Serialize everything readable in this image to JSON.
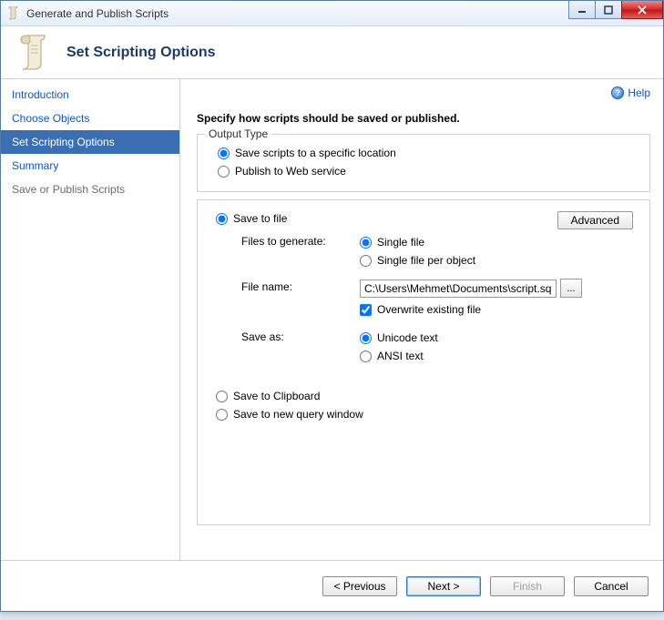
{
  "window": {
    "title": "Generate and Publish Scripts"
  },
  "header": {
    "title": "Set Scripting Options"
  },
  "help": {
    "label": "Help"
  },
  "sidebar": {
    "items": [
      {
        "label": "Introduction",
        "state": "done"
      },
      {
        "label": "Choose Objects",
        "state": "done"
      },
      {
        "label": "Set Scripting Options",
        "state": "selected"
      },
      {
        "label": "Summary",
        "state": "done"
      },
      {
        "label": "Save or Publish Scripts",
        "state": "pending"
      }
    ]
  },
  "content": {
    "instruction": "Specify how scripts should be saved or published.",
    "output_type": {
      "legend": "Output Type",
      "option_save_location": "Save scripts to a specific location",
      "option_publish_web": "Publish to Web service"
    },
    "save_to_file": {
      "label": "Save to file",
      "advanced_button": "Advanced",
      "files_to_generate_label": "Files to generate:",
      "single_file": "Single file",
      "single_file_per_object": "Single file per object",
      "file_name_label": "File name:",
      "file_name_value": "C:\\Users\\Mehmet\\Documents\\script.sql",
      "browse_button": "...",
      "overwrite_label": "Overwrite existing file",
      "save_as_label": "Save as:",
      "unicode_text": "Unicode text",
      "ansi_text": "ANSI text"
    },
    "save_to_clipboard": "Save to Clipboard",
    "save_to_new_query": "Save to new query window"
  },
  "footer": {
    "previous": "< Previous",
    "next": "Next >",
    "finish": "Finish",
    "cancel": "Cancel"
  }
}
